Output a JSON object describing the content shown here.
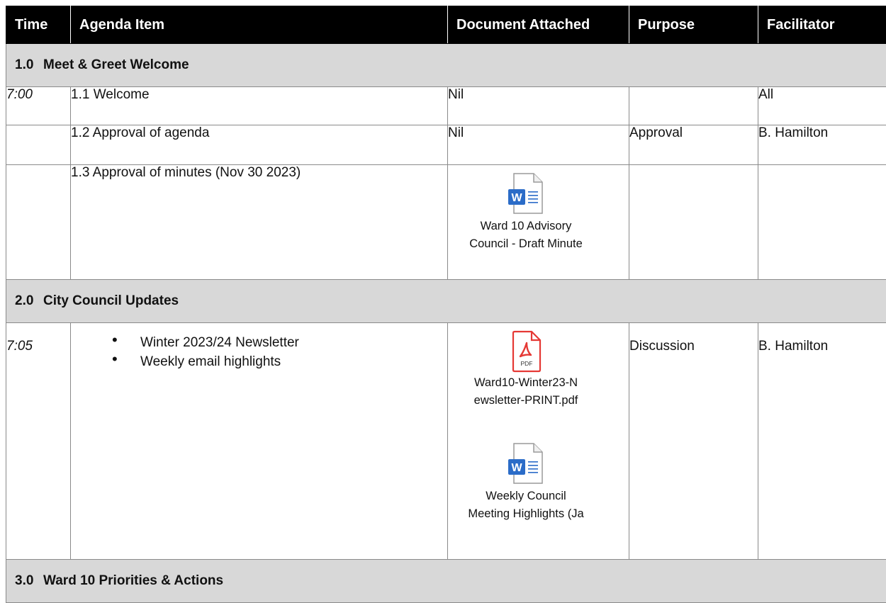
{
  "header": {
    "time": "Time",
    "agenda_item": "Agenda Item",
    "document": "Document Attached",
    "purpose": "Purpose",
    "facilitator": "Facilitator"
  },
  "sections": [
    {
      "number": "1.0",
      "title": "Meet & Greet Welcome"
    },
    {
      "number": "2.0",
      "title": "City Council Updates"
    },
    {
      "number": "3.0",
      "title": "Ward 10 Priorities & Actions"
    }
  ],
  "rows": [
    {
      "time": "7:00",
      "item": "1.1 Welcome",
      "document": "Nil",
      "purpose": "",
      "facilitator": "All"
    },
    {
      "time": "",
      "item": "1.2 Approval of agenda",
      "document": "Nil",
      "purpose": "Approval",
      "facilitator": "B. Hamilton"
    },
    {
      "time": "",
      "item": "1.3 Approval of minutes (Nov 30 2023)",
      "purpose": "",
      "facilitator": "",
      "attachment": {
        "icon": "word-doc-icon",
        "line1": "Ward 10 Advisory",
        "line2": "Council - Draft Minute"
      }
    },
    {
      "time": "7:05",
      "bullets": [
        "Winter 2023/24 Newsletter",
        "Weekly email highlights"
      ],
      "purpose": "Discussion",
      "facilitator": "B. Hamilton",
      "attachments": [
        {
          "icon": "pdf-icon",
          "badge": "PDF",
          "line1": "Ward10-Winter23-N",
          "line2": "ewsletter-PRINT.pdf"
        },
        {
          "icon": "word-doc-icon",
          "line1": "Weekly Council",
          "line2": "Meeting Highlights (Ja"
        }
      ]
    }
  ],
  "colors": {
    "header_bg": "#000000",
    "section_bg": "#d8d8d8",
    "word_blue": "#2b6cc8",
    "pdf_red": "#e53935"
  }
}
